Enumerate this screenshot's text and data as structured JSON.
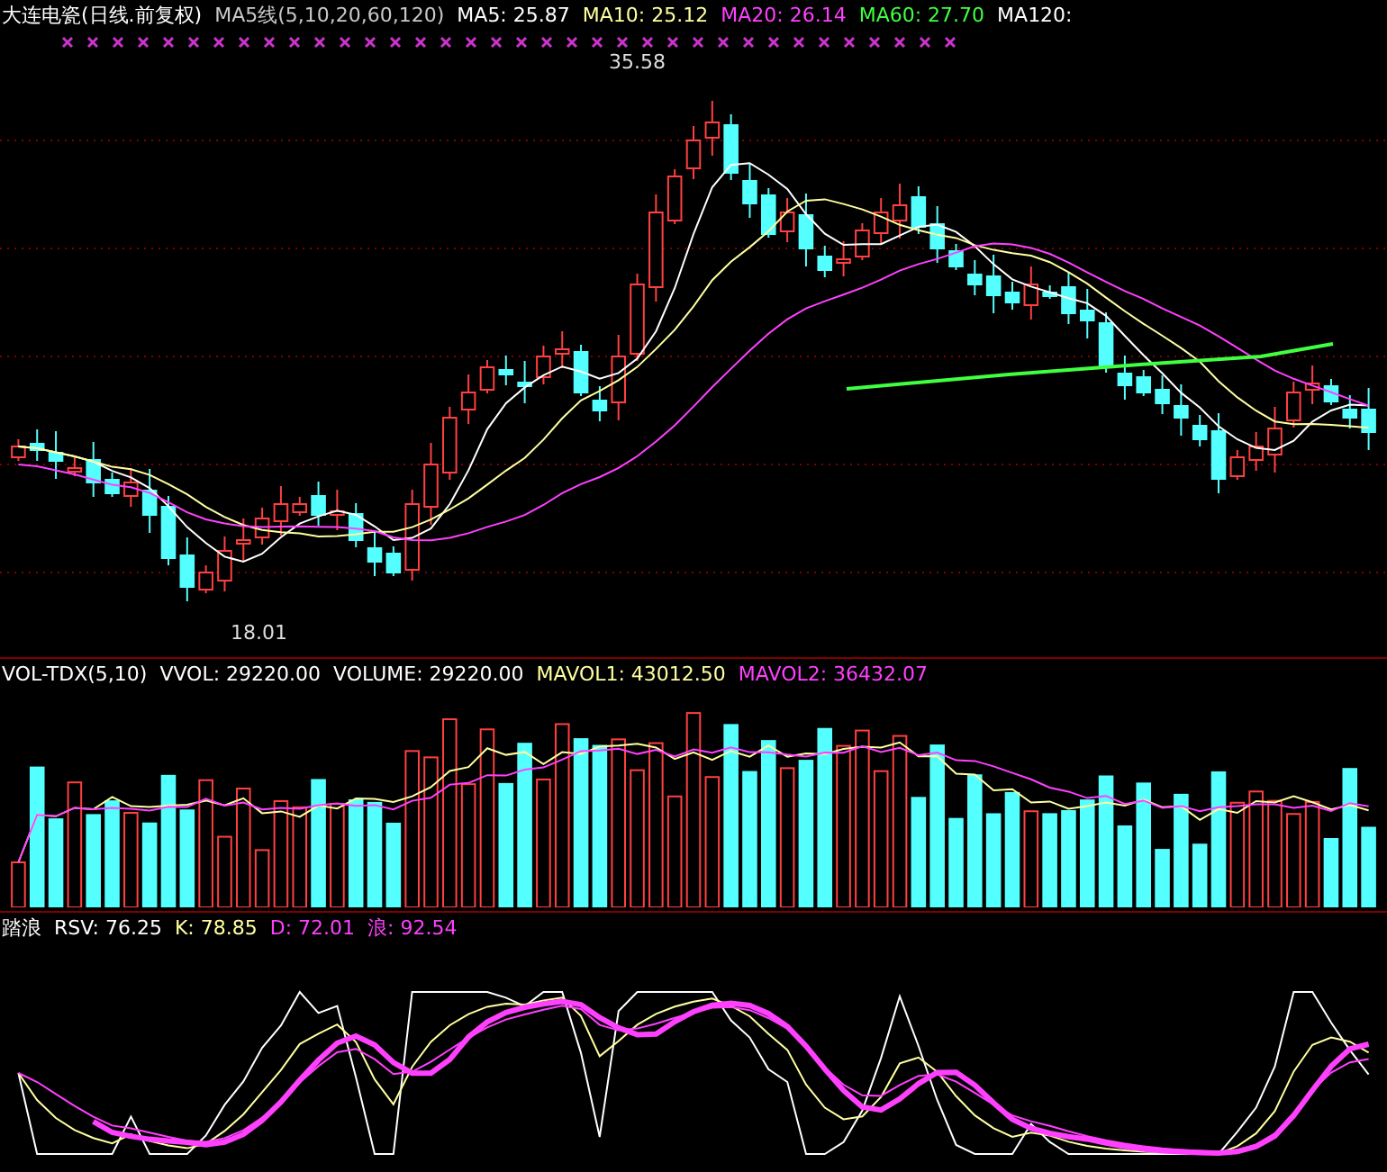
{
  "main_panel": {
    "header": [
      {
        "text": "大连电瓷(日线.前复权)",
        "color": "#ffffff"
      },
      {
        "text": "MA5线(5,10,20,60,120)",
        "color": "#c8c8c8"
      },
      {
        "text": "MA5: 25.87",
        "color": "#ffffff"
      },
      {
        "text": "MA10: 25.12",
        "color": "#ffffa0"
      },
      {
        "text": "MA20: 26.14",
        "color": "#ff40ff"
      },
      {
        "text": "MA60: 27.70",
        "color": "#40ff40"
      },
      {
        "text": "MA120:",
        "color": "#ffffff"
      }
    ],
    "high_label": "35.58",
    "low_label": "18.01"
  },
  "volume_panel": {
    "header": [
      {
        "text": "VOL-TDX(5,10)",
        "color": "#ffffff"
      },
      {
        "text": "VVOL: 29220.00",
        "color": "#ffffff"
      },
      {
        "text": "VOLUME: 29220.00",
        "color": "#ffffff"
      },
      {
        "text": "MAVOL1: 43012.50",
        "color": "#ffffa0"
      },
      {
        "text": "MAVOL2: 36432.07",
        "color": "#ff40ff"
      }
    ]
  },
  "kdj_panel": {
    "header": [
      {
        "text": "踏浪",
        "color": "#ffffff"
      },
      {
        "text": "RSV: 76.25",
        "color": "#ffffff"
      },
      {
        "text": "K: 78.85",
        "color": "#ffffa0"
      },
      {
        "text": "D: 72.01",
        "color": "#ff40ff"
      },
      {
        "text": "浪: 92.54",
        "color": "#ff40ff"
      }
    ]
  }
}
